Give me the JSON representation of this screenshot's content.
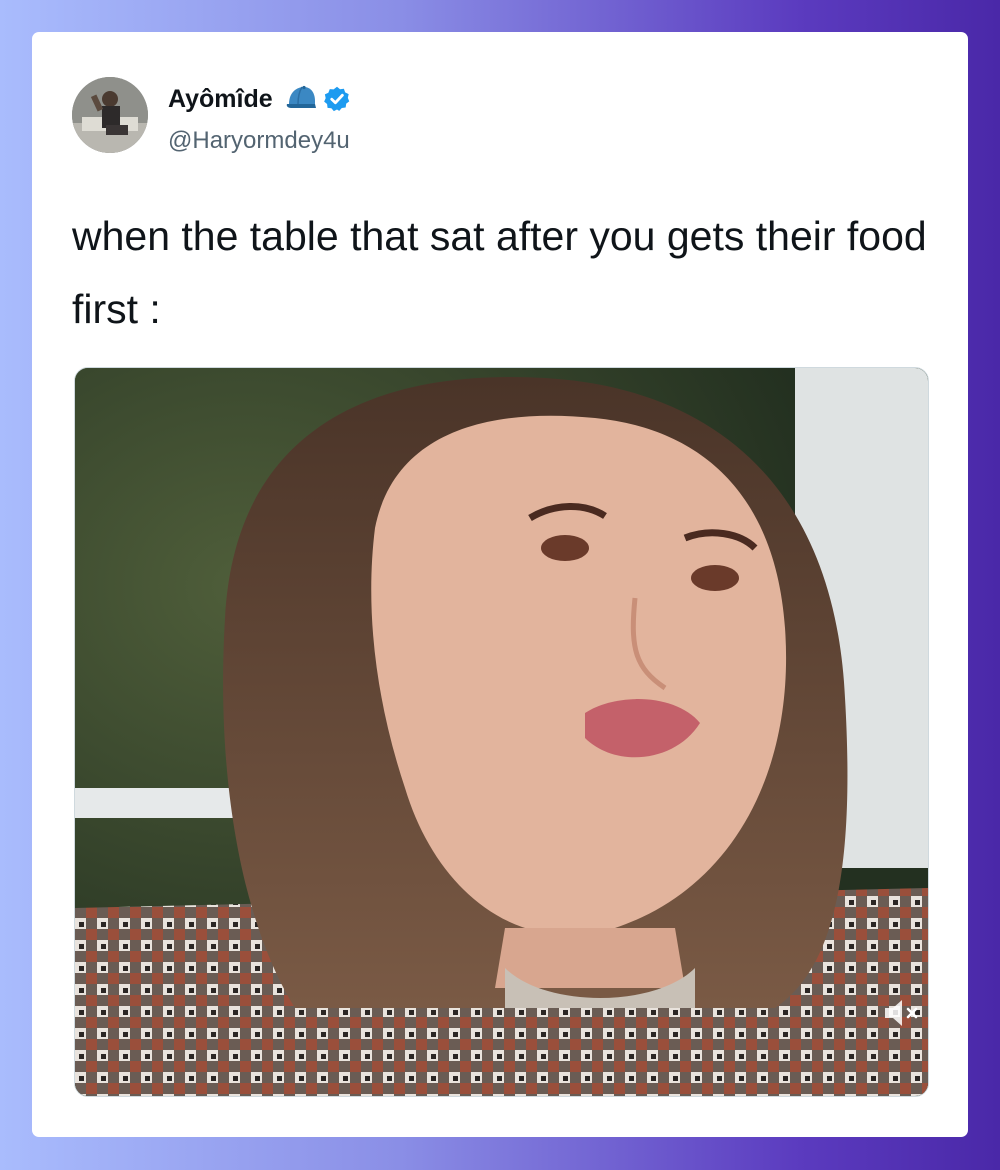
{
  "tweet": {
    "display_name": "Ayômîde",
    "handle": "@Haryormdey4u",
    "verified": true,
    "name_emoji_icon": "blue-cap-emoji-icon",
    "text": "when the table that sat after you gets their food first :"
  },
  "media": {
    "type": "video",
    "mute_icon": "speaker-muted-icon"
  },
  "colors": {
    "verified_blue": "#1d9bf0",
    "handle_gray": "#536471",
    "text_dark": "#0f1419"
  }
}
